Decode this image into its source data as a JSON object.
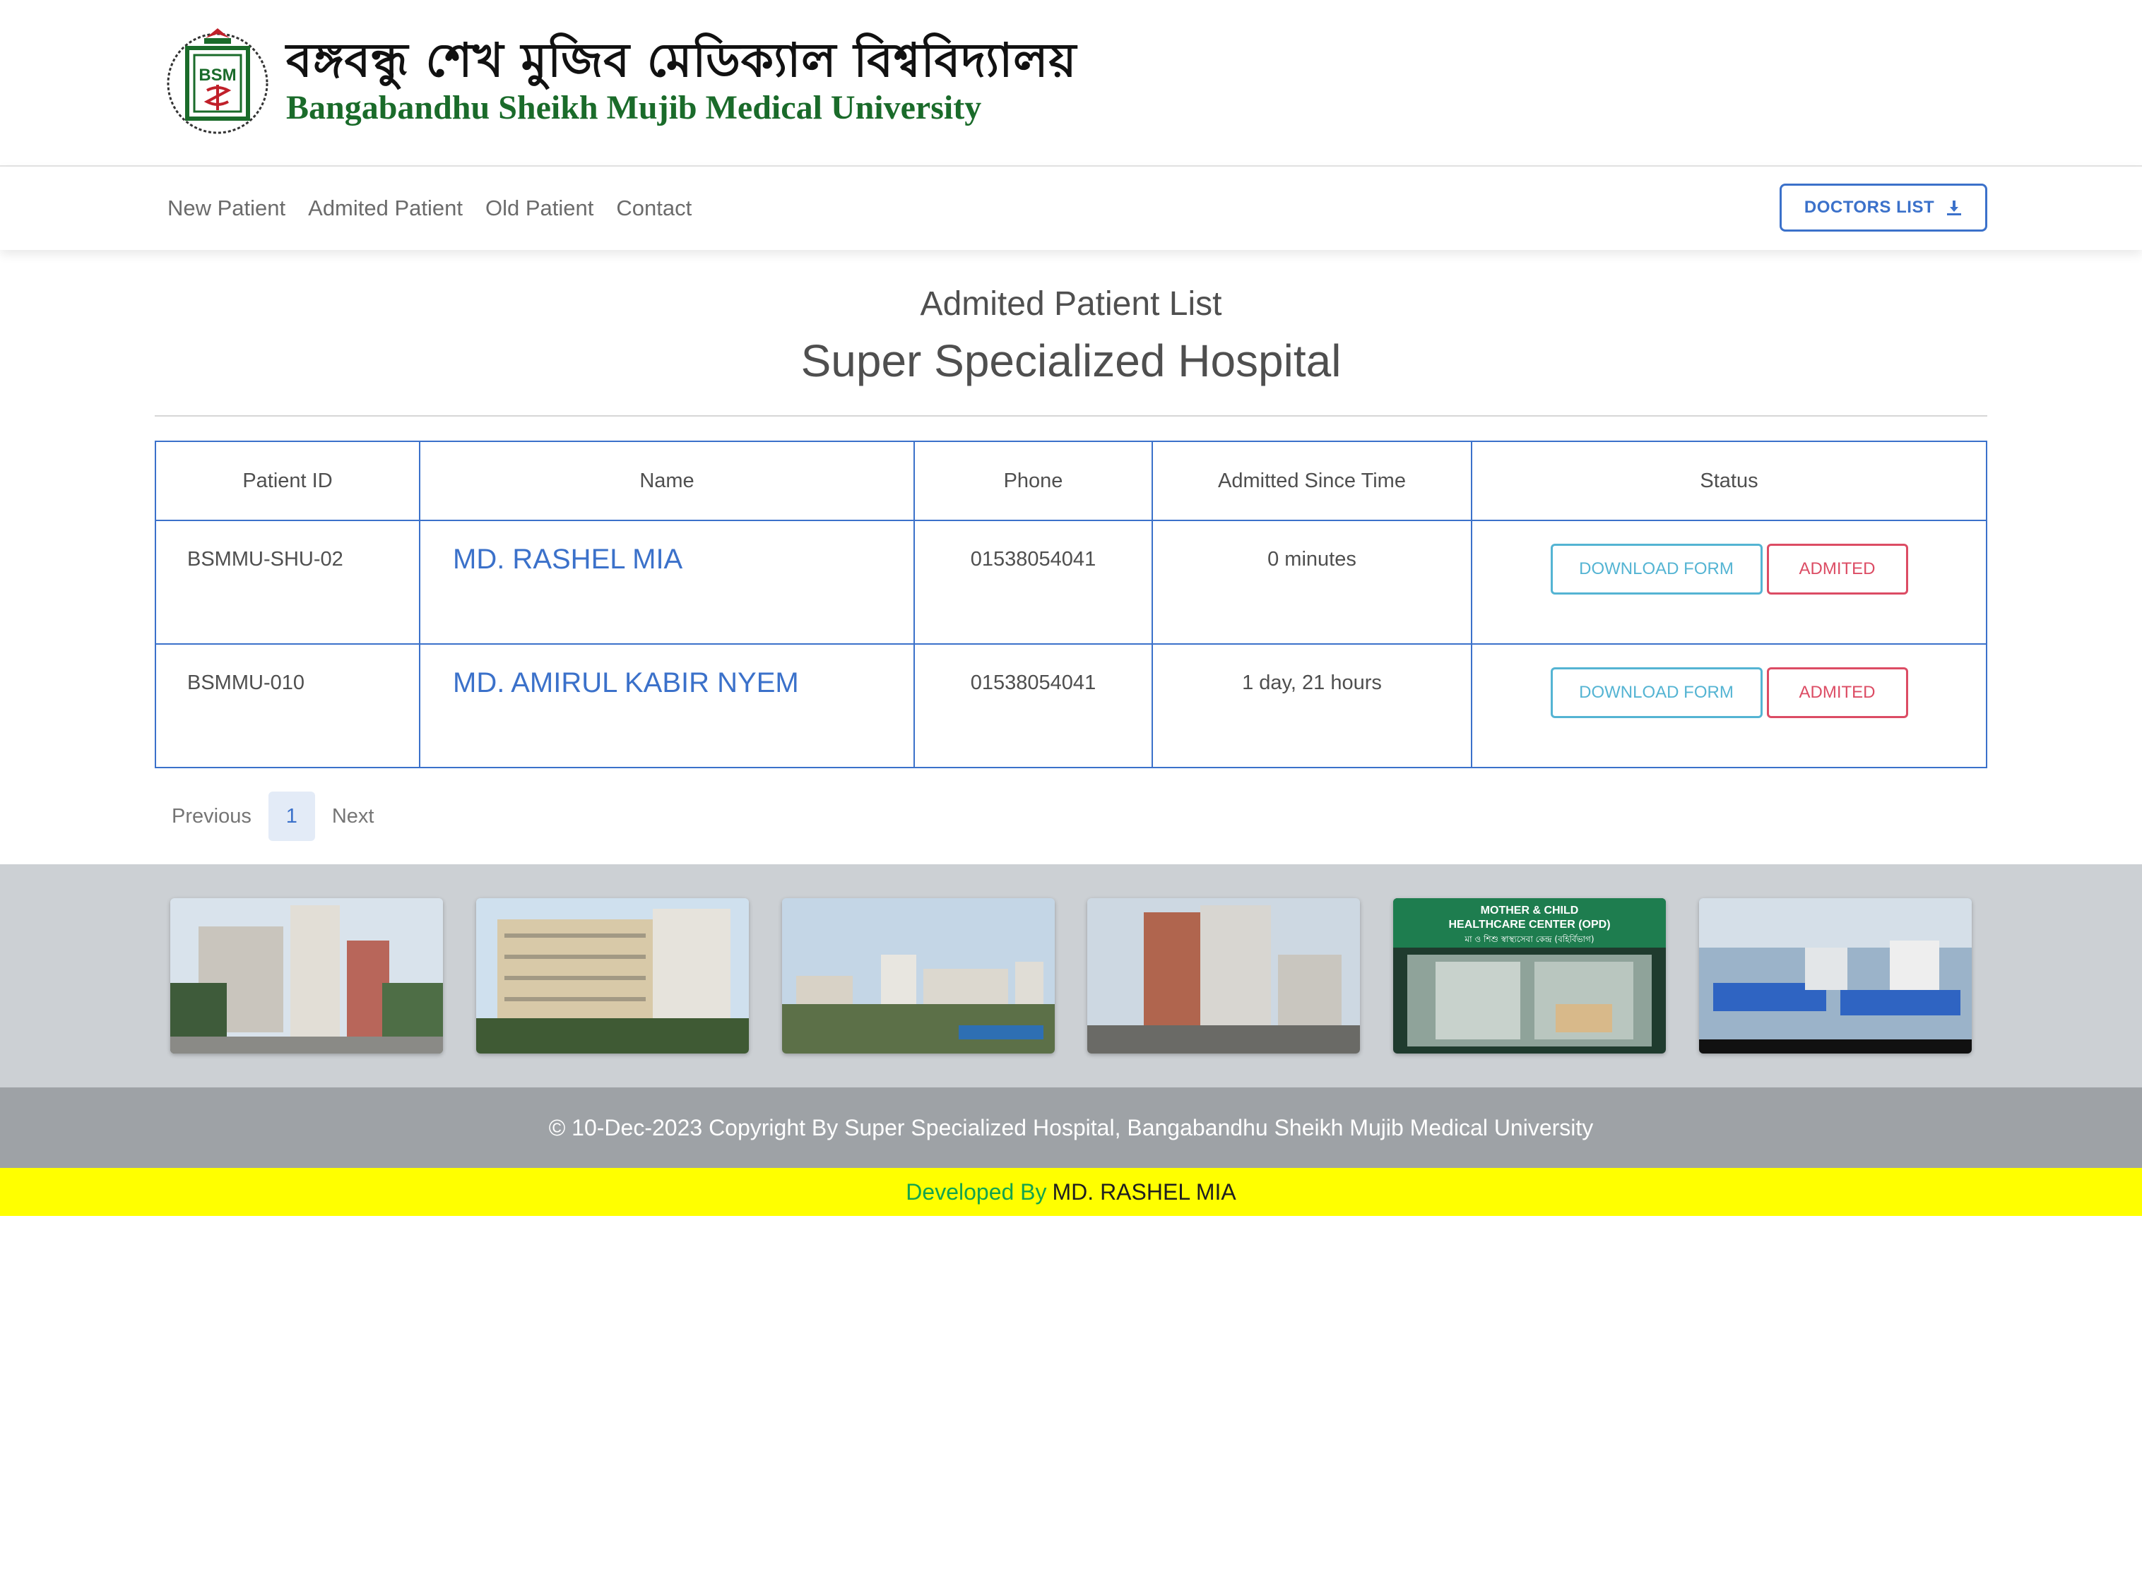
{
  "header": {
    "logo_bn": "বঙ্গবন্ধু শেখ মুজিব মেডিক্যাল বিশ্ববিদ্যালয়",
    "logo_en": "Bangabandhu Sheikh Mujib Medical University",
    "seal_text": "BSM"
  },
  "nav": {
    "items": [
      "New Patient",
      "Admited Patient",
      "Old Patient",
      "Contact"
    ],
    "doctors_button": "DOCTORS LIST"
  },
  "page": {
    "title": "Admited Patient List",
    "subtitle": "Super Specialized Hospital"
  },
  "table": {
    "headers": [
      "Patient ID",
      "Name",
      "Phone",
      "Admitted Since Time",
      "Status"
    ],
    "rows": [
      {
        "id": "BSMMU-SHU-02",
        "name": "MD. RASHEL MIA",
        "phone": "01538054041",
        "since": "0 minutes",
        "download": "DOWNLOAD FORM",
        "status": "ADMITED"
      },
      {
        "id": "BSMMU-010",
        "name": "MD. AMIRUL KABIR NYEM",
        "phone": "01538054041",
        "since": "1 day, 21 hours",
        "download": "DOWNLOAD FORM",
        "status": "ADMITED"
      }
    ]
  },
  "pagination": {
    "previous": "Previous",
    "current": "1",
    "next": "Next"
  },
  "gallery": {
    "images": [
      "hospital-building-photo",
      "university-building-photo",
      "campus-panorama-photo",
      "hospital-tower-photo",
      "mother-child-healthcare-center-photo",
      "hospital-ward-beds-photo"
    ],
    "sign_line1": "MOTHER & CHILD",
    "sign_line2": "HEALTHCARE CENTER (OPD)",
    "sign_line3": "মা ও শিশু স্বাস্থ্যসেবা কেন্দ্র (বহির্বিভাগ)"
  },
  "footer": {
    "copyright": "© 10-Dec-2023 Copyright By Super Specialized Hospital, Bangabandhu Sheikh Mujib Medical University",
    "developed_by": "Developed By",
    "developer": "MD. RASHEL MIA"
  },
  "colors": {
    "primary": "#3b71ca",
    "info": "#54b4d3",
    "danger": "#dc4c64",
    "logo_green": "#1a6b2a",
    "dev_green": "#14a44d",
    "dev_bar": "#ffff00",
    "footer_bg": "#9ea2a6",
    "gallery_bg": "#ccd0d4"
  }
}
